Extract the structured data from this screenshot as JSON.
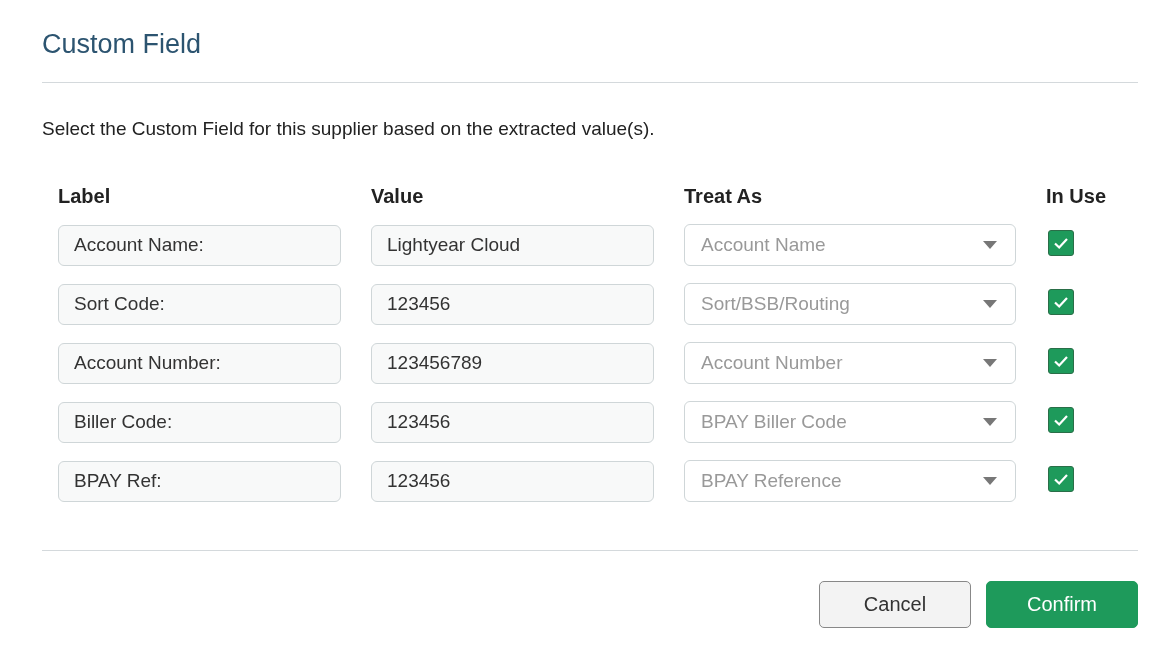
{
  "dialog": {
    "title": "Custom Field",
    "description": "Select the Custom Field for this supplier based on the extracted value(s).",
    "table": {
      "columns": [
        "Label",
        "Value",
        "Treat As",
        "In Use"
      ],
      "rows": [
        {
          "label": "Account Name:",
          "value": "Lightyear Cloud",
          "treat_as": "Account Name",
          "in_use": true
        },
        {
          "label": "Sort Code:",
          "value": "123456",
          "treat_as": "Sort/BSB/Routing",
          "in_use": true
        },
        {
          "label": "Account Number:",
          "value": "123456789",
          "treat_as": "Account Number",
          "in_use": true
        },
        {
          "label": "Biller Code:",
          "value": "123456",
          "treat_as": "BPAY Biller Code",
          "in_use": true
        },
        {
          "label": "BPAY Ref:",
          "value": "123456",
          "treat_as": "BPAY Reference",
          "in_use": true
        }
      ]
    },
    "buttons": [
      {
        "label": "Cancel",
        "kind": "secondary"
      },
      {
        "label": "Confirm",
        "kind": "primary"
      }
    ]
  }
}
